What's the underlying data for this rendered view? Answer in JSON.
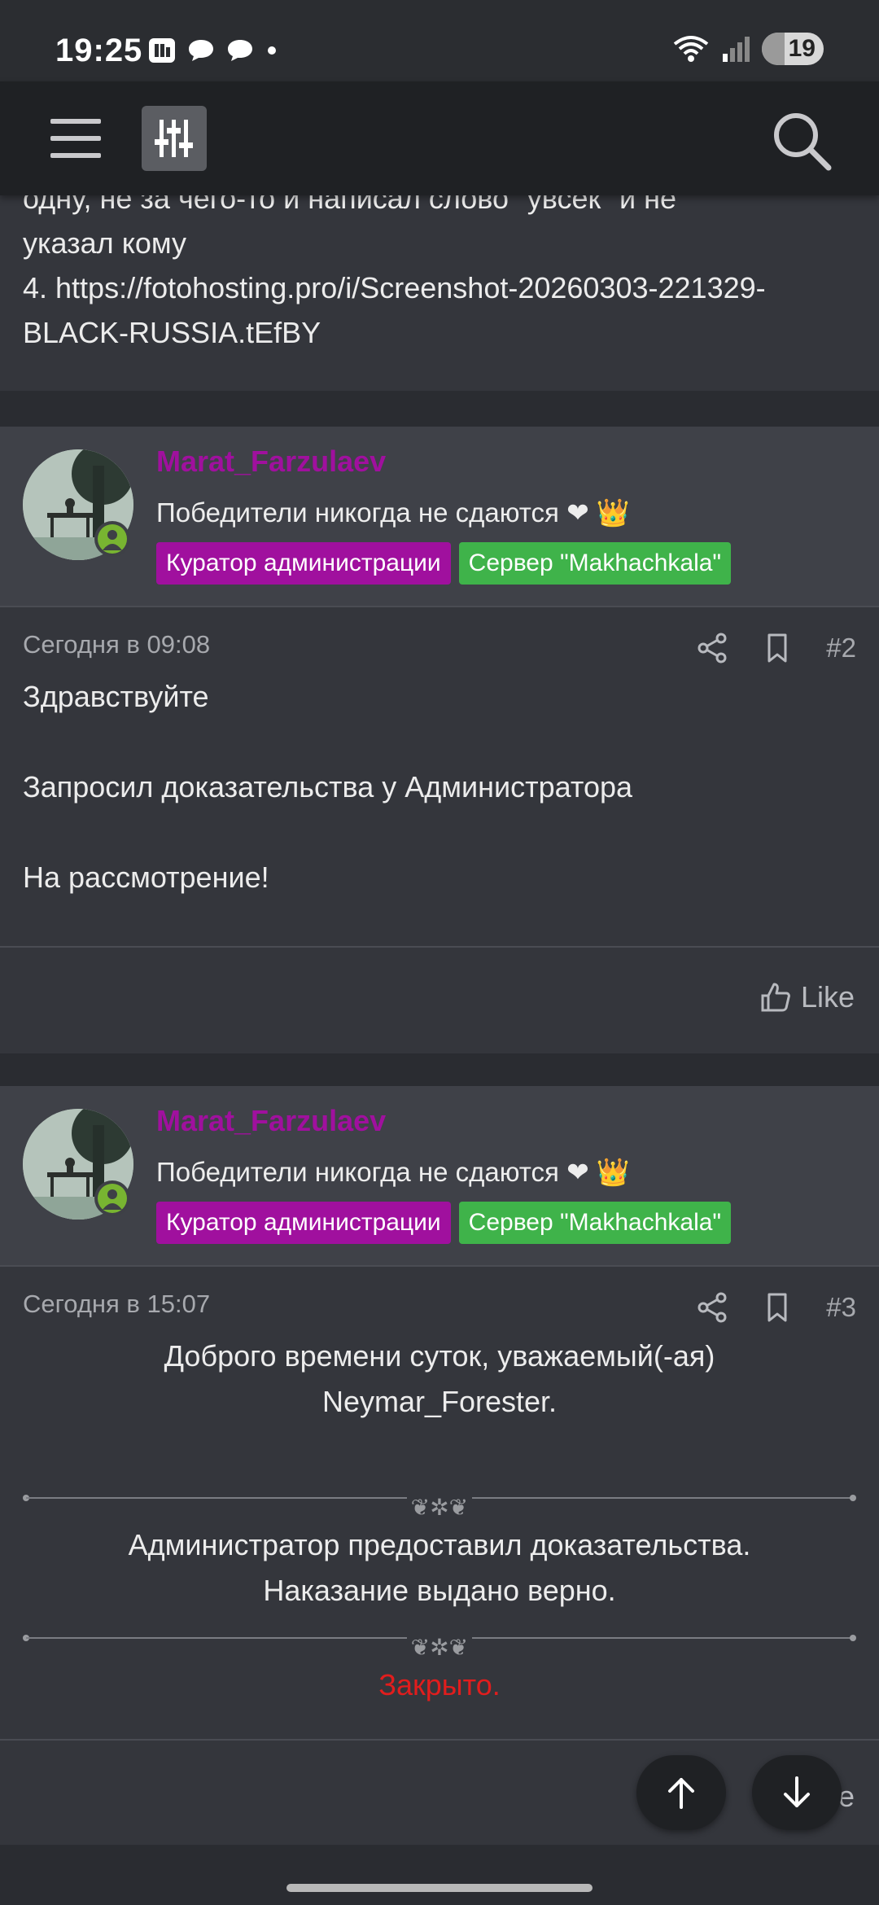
{
  "status_bar": {
    "time": "19:25",
    "battery": "19",
    "icons": [
      "calendar-app-icon",
      "chat-bubble-icon",
      "chat-bubble-icon",
      "dot-icon",
      "wifi-icon",
      "signal-icon",
      "battery-icon"
    ]
  },
  "appbar": {
    "icons": [
      "menu-icon",
      "filter-sliders-icon",
      "search-icon"
    ]
  },
  "top_post_fragment": {
    "line1": "4. https://fotohosting.pro/i/Screenshot-20260303-221329-BLACK-RUSSIA.tEfBY",
    "line0": "указал кому",
    "line_cut": "одну, не за чего-то и написал слово \"увсек\" и не"
  },
  "posts": [
    {
      "username": "Marat_Farzulaev",
      "user_title": "Победители никогда не сдаются ❤ 👑",
      "badges": [
        "Куратор администрации",
        "Сервер \"Makhachkala\""
      ],
      "date": "Сегодня в 09:08",
      "number": "#2",
      "body": [
        "Здравствуйте",
        "Запросил доказательства у Администратора",
        "На рассмотрение!"
      ],
      "like_label": "Like"
    },
    {
      "username": "Marat_Farzulaev",
      "user_title": "Победители никогда не сдаются ❤ 👑",
      "badges": [
        "Куратор администрации",
        "Сервер \"Makhachkala\""
      ],
      "date": "Сегодня в 15:07",
      "number": "#3",
      "greeting_line1": "Доброго времени суток, уважаемый(-ая)",
      "greeting_line2": "Neymar_Forester.",
      "verdict_line1": "Администратор предоставил доказательства.",
      "verdict_line2": "Наказание выдано верно.",
      "status": "Закрыто.",
      "like_partial": "e"
    }
  ],
  "colors": {
    "background": "#2a2c31",
    "card": "#34363c",
    "header": "#3f4148",
    "username": "#a0109e",
    "badge_purple": "#a0109e",
    "badge_green": "#3fb34a",
    "closed": "#e11d1d"
  }
}
